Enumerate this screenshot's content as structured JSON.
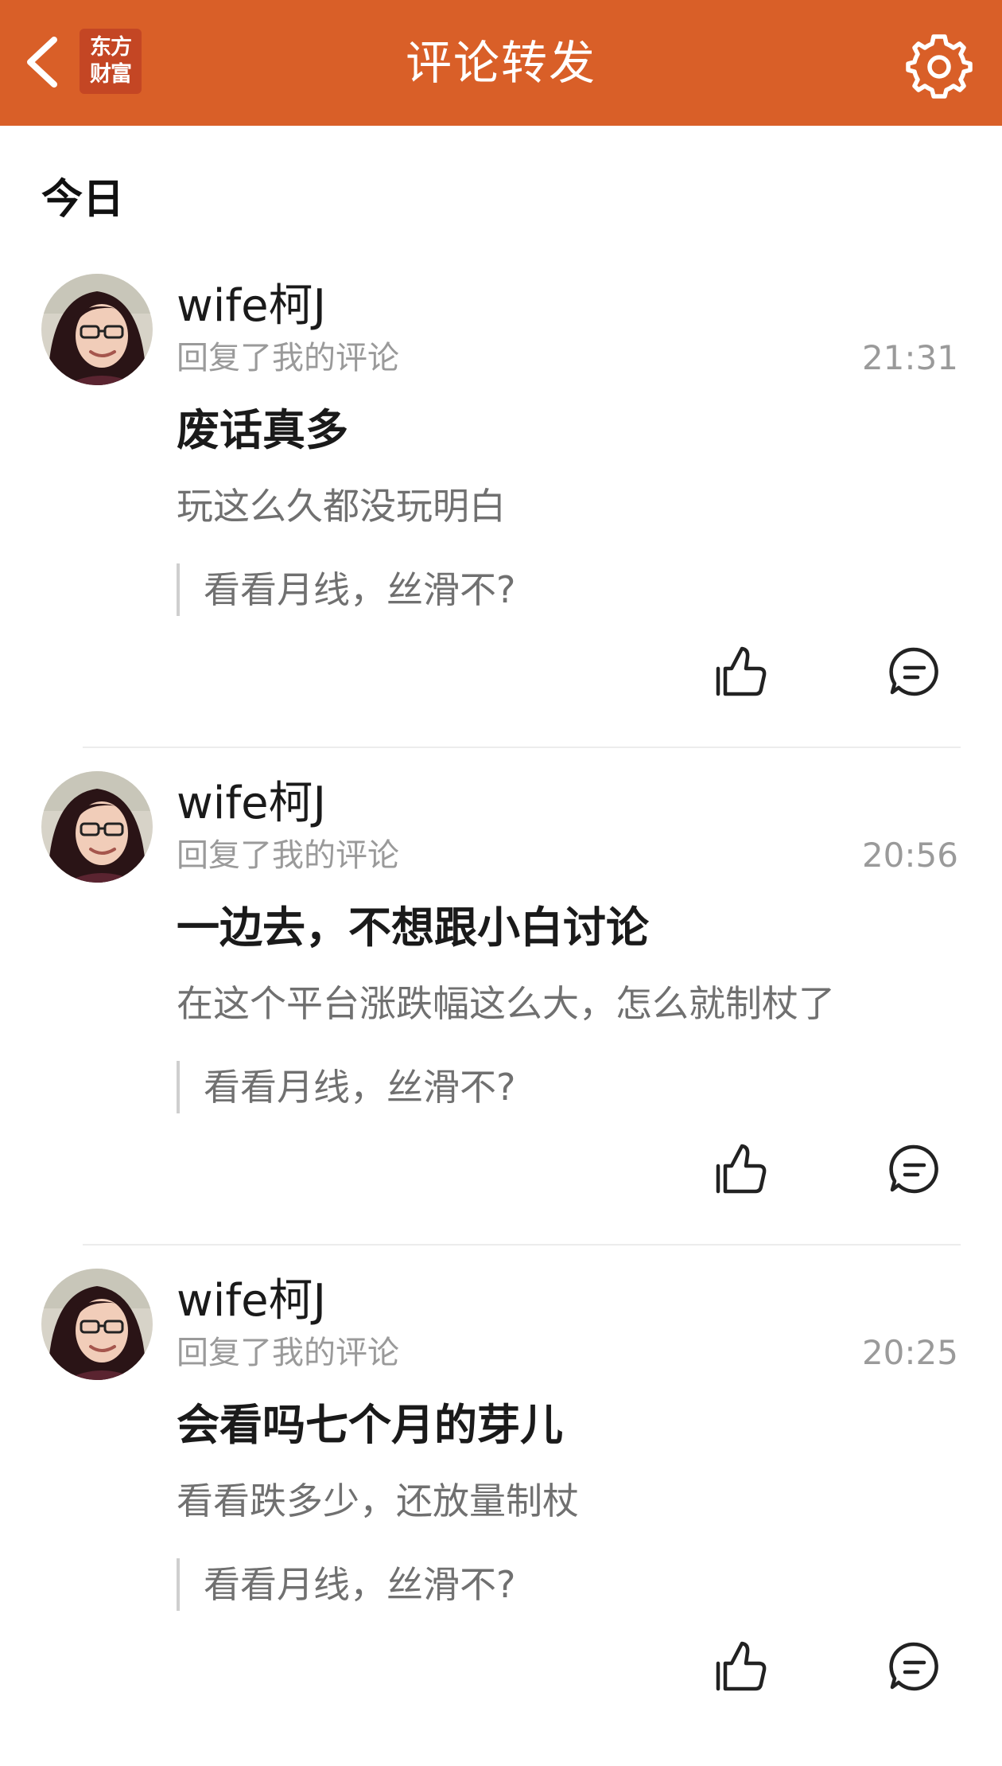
{
  "header": {
    "title": "评论转发",
    "logo_line1": "东方",
    "logo_line2": "财富",
    "back_icon": "chevron-left-icon",
    "settings_icon": "gear-icon",
    "background_color": "#d95f28"
  },
  "section": {
    "label": "今日"
  },
  "items": [
    {
      "username": "wife柯J",
      "subtitle": "回复了我的评论",
      "time": "21:31",
      "reply": "废话真多",
      "my_comment": "玩这么久都没玩明白",
      "quote": "看看月线，丝滑不?"
    },
    {
      "username": "wife柯J",
      "subtitle": "回复了我的评论",
      "time": "20:56",
      "reply": "一边去，不想跟小白讨论",
      "my_comment": "在这个平台涨跌幅这么大，怎么就制杖了",
      "quote": "看看月线，丝滑不?"
    },
    {
      "username": "wife柯J",
      "subtitle": "回复了我的评论",
      "time": "20:25",
      "reply": "会看吗七个月的芽儿",
      "my_comment": "看看跌多少，还放量制杖",
      "quote": "看看月线，丝滑不?"
    }
  ]
}
